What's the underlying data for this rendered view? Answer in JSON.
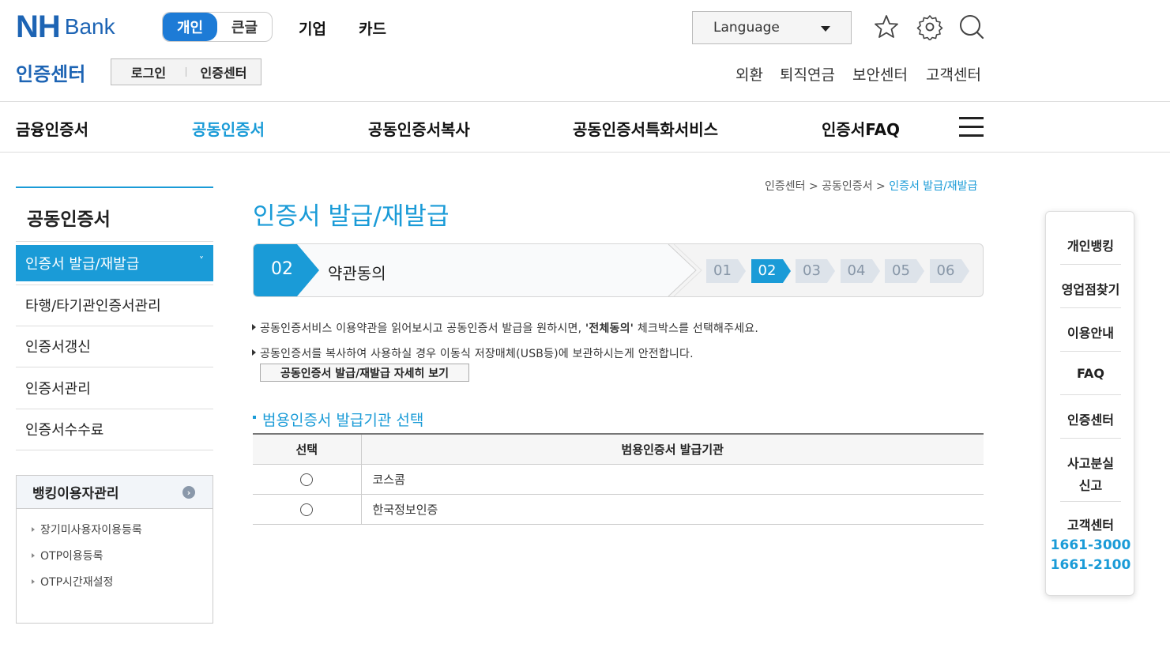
{
  "brand": {
    "logo_nh": "NH",
    "logo_bank": "Bank"
  },
  "mode_toggle": {
    "personal": "개인",
    "large_text": "큰글"
  },
  "top_nav": {
    "business": "기업",
    "card": "카드"
  },
  "language": {
    "label": "Language"
  },
  "section_title": "인증센터",
  "login_links": {
    "login": "로그인",
    "cert_center": "인증센터"
  },
  "util_links": [
    "외환",
    "퇴직연금",
    "보안센터",
    "고객센터"
  ],
  "gnb": [
    "금융인증서",
    "공동인증서",
    "공동인증서복사",
    "공동인증서특화서비스",
    "인증서FAQ"
  ],
  "gnb_active_index": 1,
  "lnb": {
    "title": "공동인증서",
    "items": [
      "인증서 발급/재발급",
      "타행/타기관인증서관리",
      "인증서갱신",
      "인증서관리",
      "인증서수수료"
    ],
    "active_index": 0,
    "active_chevron": "˅"
  },
  "sub_box": {
    "title": "뱅킹이용자관리",
    "items": [
      "장기미사용자이용등록",
      "OTP이용등록",
      "OTP시간재설정"
    ]
  },
  "breadcrumb": {
    "p1": "인증센터",
    "p2": "공동인증서",
    "current": "인증서 발급/재발급",
    "sep": ">"
  },
  "page_title": "인증서 발급/재발급",
  "steps": {
    "current_num": "02",
    "current_label": "약관동의",
    "all": [
      "01",
      "02",
      "03",
      "04",
      "05",
      "06"
    ],
    "current_index": 1
  },
  "notes": {
    "line1_pre": "공동인증서비스 이용약관을 읽어보시고 공동인증서 발급을 원하시면, ",
    "line1_bold": "'전체동의'",
    "line1_post": " 체크박스를 선택해주세요.",
    "line2": "공동인증서를 복사하여 사용하실 경우 이동식 저장매체(USB등)에 보관하시는게 안전합니다.",
    "detail_button": "공동인증서 발급/재발급 자세히 보기"
  },
  "issuer_section": {
    "title": "범용인증서 발급기관 선택",
    "columns": [
      "선택",
      "범용인증서 발급기관"
    ],
    "rows": [
      "코스콤",
      "한국정보인증"
    ]
  },
  "quick_menu": {
    "items": [
      "개인뱅킹",
      "영업점찾기",
      "이용안내",
      "FAQ",
      "인증센터"
    ],
    "loss_report": [
      "사고분실",
      "신고"
    ],
    "customer_center": "고객센터",
    "phones": [
      "1661-3000",
      "1661-2100"
    ]
  },
  "colors": {
    "brand_blue": "#1d64b4",
    "accent": "#1a9bd7",
    "step_active": "#1a9bd7"
  }
}
